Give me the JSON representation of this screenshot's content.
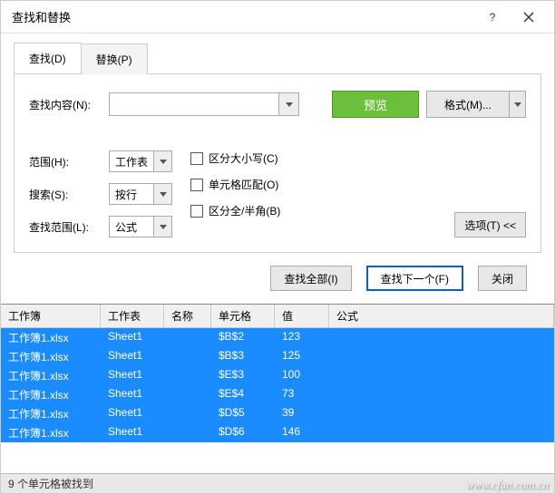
{
  "window": {
    "title": "查找和替换"
  },
  "tabs": {
    "find": "查找(D)",
    "replace": "替换(P)"
  },
  "labels": {
    "find_content": "查找内容(N):",
    "scope": "范围(H):",
    "search": "搜索(S):",
    "lookin": "查找范围(L):"
  },
  "buttons": {
    "preview": "预览",
    "format": "格式(M)...",
    "options": "选项(T) <<",
    "find_all": "查找全部(I)",
    "find_next": "查找下一个(F)",
    "close": "关闭"
  },
  "selects": {
    "scope_value": "工作表",
    "search_value": "按行",
    "lookin_value": "公式"
  },
  "checkboxes": {
    "match_case": "区分大小写(C)",
    "match_cell": "单元格匹配(O)",
    "match_width": "区分全/半角(B)"
  },
  "results": {
    "headers": {
      "workbook": "工作簿",
      "worksheet": "工作表",
      "name": "名称",
      "cell": "单元格",
      "value": "值",
      "formula": "公式"
    },
    "rows": [
      {
        "workbook": "工作簿1.xlsx",
        "worksheet": "Sheet1",
        "name": "",
        "cell": "$B$2",
        "value": "123",
        "formula": ""
      },
      {
        "workbook": "工作簿1.xlsx",
        "worksheet": "Sheet1",
        "name": "",
        "cell": "$B$3",
        "value": "125",
        "formula": ""
      },
      {
        "workbook": "工作簿1.xlsx",
        "worksheet": "Sheet1",
        "name": "",
        "cell": "$E$3",
        "value": "100",
        "formula": ""
      },
      {
        "workbook": "工作簿1.xlsx",
        "worksheet": "Sheet1",
        "name": "",
        "cell": "$E$4",
        "value": "73",
        "formula": ""
      },
      {
        "workbook": "工作簿1.xlsx",
        "worksheet": "Sheet1",
        "name": "",
        "cell": "$D$5",
        "value": "39",
        "formula": ""
      },
      {
        "workbook": "工作簿1.xlsx",
        "worksheet": "Sheet1",
        "name": "",
        "cell": "$D$6",
        "value": "146",
        "formula": ""
      }
    ]
  },
  "status": "9 个单元格被找到",
  "watermark": "www.cfan.com.cn"
}
